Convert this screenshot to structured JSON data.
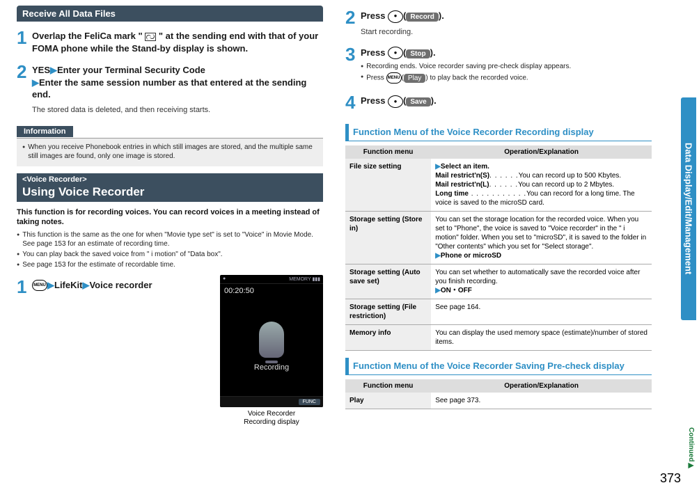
{
  "sideTab": "Data Display/Edit/Management",
  "continued": "Continued▶",
  "pageNum": "373",
  "left": {
    "header1": "Receive All Data Files",
    "step1": {
      "num": "1",
      "title_a": "Overlap the FeliCa mark \"",
      "title_b": "\" at the sending end with that of your FOMA phone while the Stand-by display is shown."
    },
    "step2": {
      "num": "2",
      "title_a": "YES",
      "title_b": "Enter your Terminal Security Code",
      "title_c": "Enter the same session number as that entered at the sending end.",
      "desc": "The stored data is deleted, and then receiving starts."
    },
    "infoLabel": "Information",
    "infoBullet": "When you receive Phonebook entries in which still images are stored, and the multiple same still images are found, only one image is stored.",
    "header2_sub": "<Voice Recorder>",
    "header2_main": "Using Voice Recorder",
    "intro_bold": "This function is for recording voices. You can record voices in a meeting instead of taking notes.",
    "intro_bullets": [
      "This function is the same as the one for when \"Movie type set\" is set to \"Voice\" in Movie Mode. See page 153 for an estimate of recording time.",
      "You can play back the saved voice from \" i motion\" of \"Data box\".",
      "See page 153 for the estimate of recordable time."
    ],
    "step1b": {
      "num": "1",
      "menuKey": "MENU",
      "a": "LifeKit",
      "b": "Voice recorder"
    },
    "screenshot": {
      "topLeft": "●",
      "topRight": "MEMORY ▮▮▮",
      "timer": "00:20:50",
      "centerLabel": "Recording",
      "softKey": "FUNC",
      "caption1": "Voice Recorder",
      "caption2": "Recording display"
    }
  },
  "right": {
    "step2": {
      "num": "2",
      "pre": "Press ",
      "keyLabel": "Record",
      "post": ".",
      "desc": "Start recording."
    },
    "step3": {
      "num": "3",
      "pre": "Press ",
      "keyLabel": "Stop",
      "post": ".",
      "b1": "Recording ends. Voice recorder saving pre-check display appears.",
      "b2_pre": "Press ",
      "b2_menu": "MENU",
      "b2_key": "Play",
      "b2_post": " to play back the recorded voice."
    },
    "step4": {
      "num": "4",
      "pre": "Press ",
      "keyLabel": "Save",
      "post": "."
    },
    "funcHeader1": "Function Menu of the Voice Recorder Recording display",
    "table1": {
      "h1": "Function menu",
      "h2": "Operation/Explanation",
      "rows": [
        {
          "k": "File size setting",
          "lines": [
            {
              "arrow": true,
              "bold": "Select an item."
            },
            {
              "bold": "Mail restrict'n(S)",
              "dots": ". . . . . .",
              "rest": "You can record up to 500 Kbytes."
            },
            {
              "bold": "Mail restrict'n(L)",
              "dots": ". . . . . .",
              "rest": "You can record up to 2 Mbytes."
            },
            {
              "bold": "Long time",
              "dots": " . . . . . . . . . . .",
              "rest": "You can record for a long time. The voice is saved to the microSD card."
            }
          ]
        },
        {
          "k": "Storage setting (Store in)",
          "text": "You can set the storage location for the recorded voice. When you set to \"Phone\", the voice is saved to \"Voice recorder\" in the \" i motion\" folder. When you set to \"microSD\", it is saved to the folder in \"Other contents\" which you set for \"Select storage\".",
          "opt": "Phone or microSD"
        },
        {
          "k": "Storage setting (Auto save set)",
          "text": "You can set whether to automatically save the recorded voice after you finish recording.",
          "opt": "ON・OFF"
        },
        {
          "k": "Storage setting (File restriction)",
          "text": "See page 164."
        },
        {
          "k": "Memory info",
          "text": "You can display the used memory space (estimate)/number of stored items."
        }
      ]
    },
    "funcHeader2": "Function Menu of the Voice Recorder Saving Pre-check display",
    "table2": {
      "h1": "Function menu",
      "h2": "Operation/Explanation",
      "rows": [
        {
          "k": "Play",
          "text": "See page 373."
        }
      ]
    }
  }
}
